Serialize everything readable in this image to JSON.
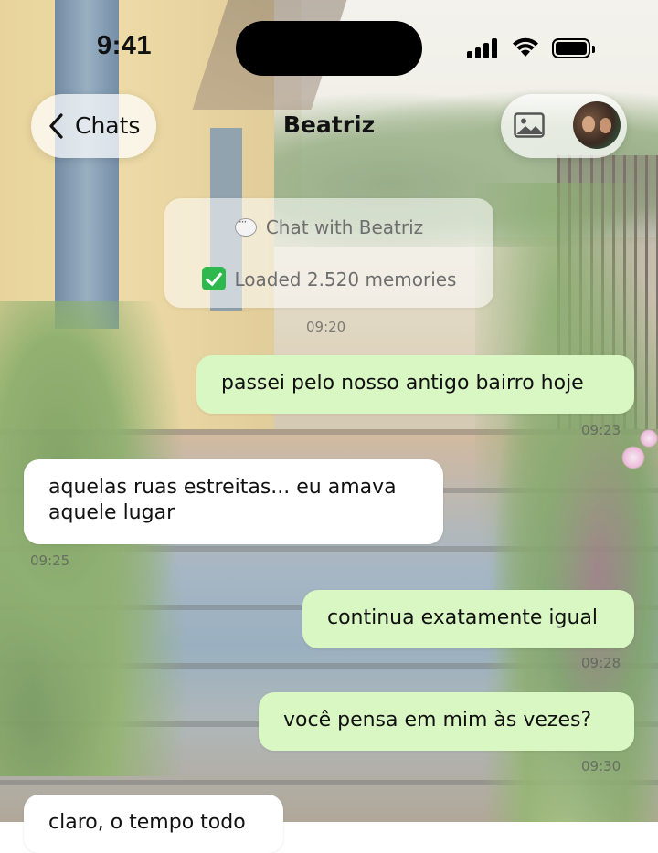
{
  "status_bar": {
    "time": "9:41"
  },
  "nav": {
    "back_label": "Chats",
    "title": "Beatriz"
  },
  "system": {
    "chat_with": "Chat with Beatriz",
    "loaded": "Loaded 2.520 memories",
    "time": "09:20"
  },
  "messages": [
    {
      "dir": "out",
      "lines": [
        "passei pelo nosso antigo bairro hoje"
      ],
      "time": "09:23"
    },
    {
      "dir": "in",
      "lines": [
        "aquelas ruas estreitas... eu amava",
        "aquele lugar"
      ],
      "time": "09:25"
    },
    {
      "dir": "out",
      "lines": [
        "continua exatamente igual"
      ],
      "time": "09:28"
    },
    {
      "dir": "out",
      "lines": [
        "você pensa em mim às vezes?"
      ],
      "time": "09:30"
    },
    {
      "dir": "in",
      "lines": [
        "claro, o tempo todo"
      ],
      "time": ""
    }
  ],
  "colors": {
    "outgoing_bubble": "#d9f7c3",
    "incoming_bubble": "#ffffff",
    "check_green": "#2fb84d"
  },
  "icons": [
    "chevron-left-icon",
    "gallery-icon",
    "chat-bubble-icon",
    "check-mark-icon",
    "signal-icon",
    "wifi-icon",
    "battery-icon"
  ]
}
